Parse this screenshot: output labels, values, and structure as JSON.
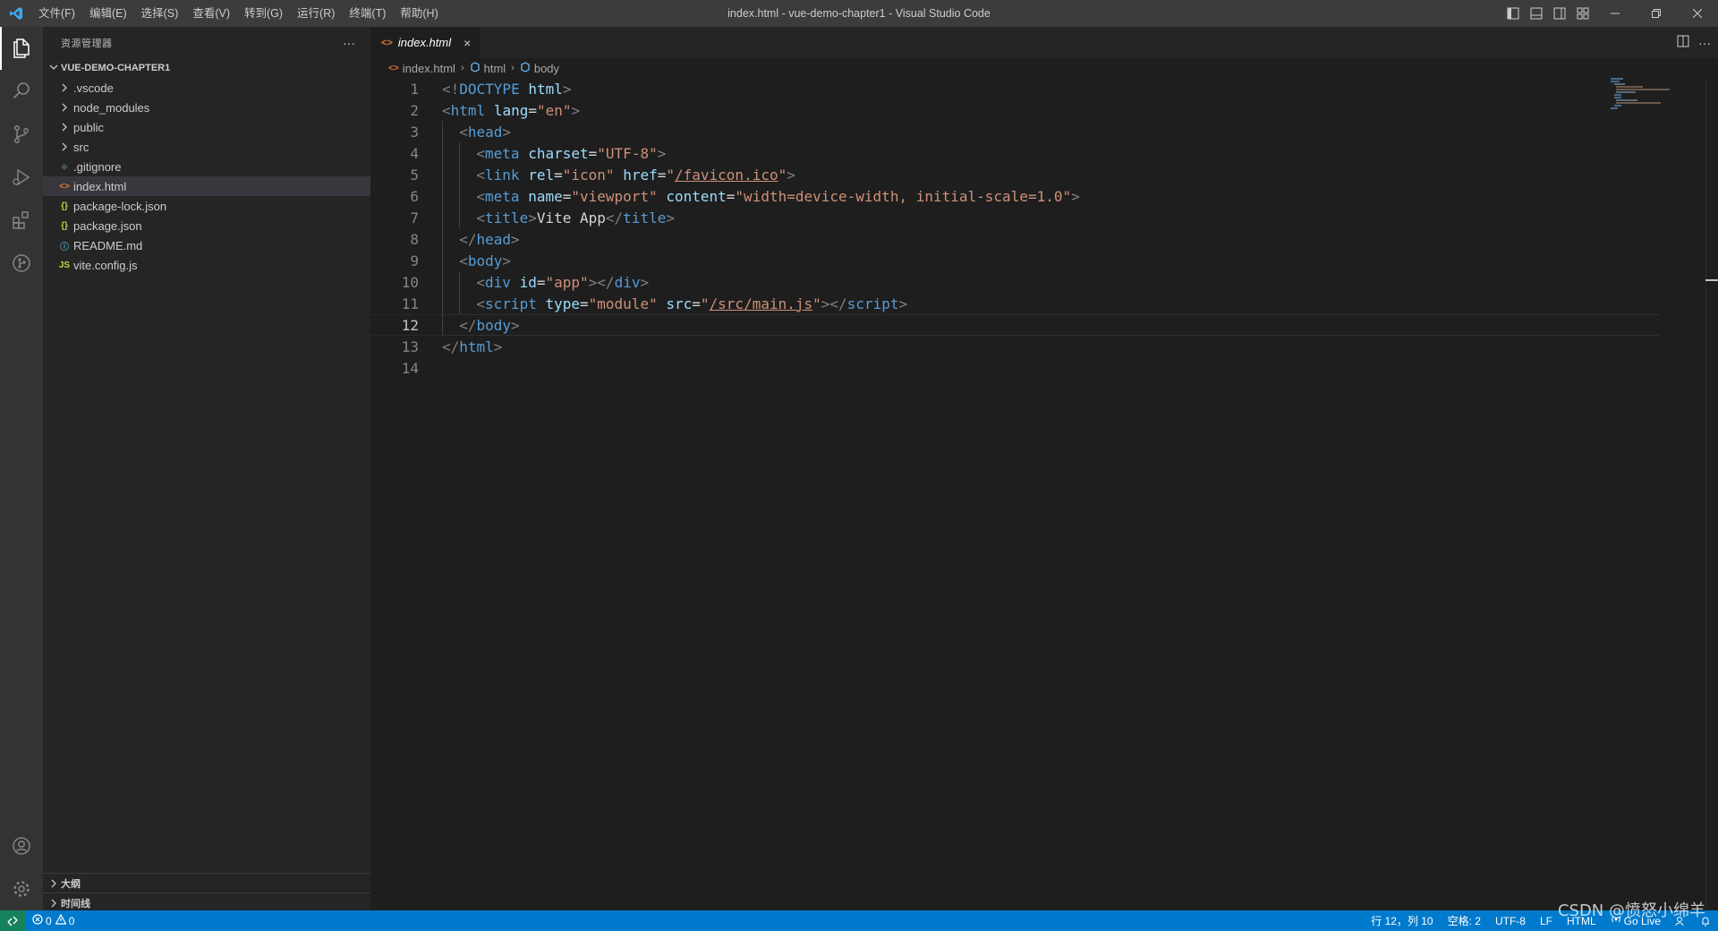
{
  "window": {
    "title": "index.html - vue-demo-chapter1 - Visual Studio Code"
  },
  "menu": [
    "文件(F)",
    "编辑(E)",
    "选择(S)",
    "查看(V)",
    "转到(G)",
    "运行(R)",
    "终端(T)",
    "帮助(H)"
  ],
  "activity_bar": {
    "top": [
      "explorer-icon",
      "search-icon",
      "source-control-icon",
      "run-debug-icon",
      "extensions-icon",
      "git-graph-icon"
    ],
    "bottom": [
      "account-icon",
      "settings-gear-icon"
    ]
  },
  "sidebar": {
    "title": "资源管理器",
    "more": "···",
    "folder": "VUE-DEMO-CHAPTER1",
    "items": [
      {
        "label": ".vscode",
        "type": "folder"
      },
      {
        "label": "node_modules",
        "type": "folder"
      },
      {
        "label": "public",
        "type": "folder"
      },
      {
        "label": "src",
        "type": "folder"
      },
      {
        "label": ".gitignore",
        "type": "git"
      },
      {
        "label": "index.html",
        "type": "html",
        "selected": true
      },
      {
        "label": "package-lock.json",
        "type": "json"
      },
      {
        "label": "package.json",
        "type": "json"
      },
      {
        "label": "README.md",
        "type": "info"
      },
      {
        "label": "vite.config.js",
        "type": "js"
      }
    ],
    "sections": [
      "大纲",
      "时间线"
    ]
  },
  "editor": {
    "tab": {
      "label": "index.html",
      "close": "×"
    },
    "more": "···",
    "breadcrumbs": [
      "index.html",
      "html",
      "body"
    ],
    "current_line": 12,
    "lines": [
      {
        "n": "1",
        "indent": 0
      },
      {
        "n": "2",
        "indent": 0
      },
      {
        "n": "3",
        "indent": 1
      },
      {
        "n": "4",
        "indent": 2
      },
      {
        "n": "5",
        "indent": 2
      },
      {
        "n": "6",
        "indent": 2
      },
      {
        "n": "7",
        "indent": 2
      },
      {
        "n": "8",
        "indent": 1
      },
      {
        "n": "9",
        "indent": 1
      },
      {
        "n": "10",
        "indent": 2
      },
      {
        "n": "11",
        "indent": 2
      },
      {
        "n": "12",
        "indent": 1
      },
      {
        "n": "13",
        "indent": 0
      },
      {
        "n": "14",
        "indent": 0
      }
    ],
    "tokens": [
      [
        [
          "punc",
          "<!"
        ],
        [
          "tag",
          "DOCTYPE"
        ],
        [
          "text",
          " "
        ],
        [
          "attr",
          "html"
        ],
        [
          "punc",
          ">"
        ]
      ],
      [
        [
          "punc",
          "<"
        ],
        [
          "tag",
          "html"
        ],
        [
          "text",
          " "
        ],
        [
          "attr",
          "lang"
        ],
        [
          "text",
          "="
        ],
        [
          "str",
          "\"en\""
        ],
        [
          "punc",
          ">"
        ]
      ],
      [
        [
          "punc",
          "<"
        ],
        [
          "tag",
          "head"
        ],
        [
          "punc",
          ">"
        ]
      ],
      [
        [
          "punc",
          "<"
        ],
        [
          "tag",
          "meta"
        ],
        [
          "text",
          " "
        ],
        [
          "attr",
          "charset"
        ],
        [
          "text",
          "="
        ],
        [
          "str",
          "\"UTF-8\""
        ],
        [
          "punc",
          ">"
        ]
      ],
      [
        [
          "punc",
          "<"
        ],
        [
          "tag",
          "link"
        ],
        [
          "text",
          " "
        ],
        [
          "attr",
          "rel"
        ],
        [
          "text",
          "="
        ],
        [
          "str",
          "\"icon\""
        ],
        [
          "text",
          " "
        ],
        [
          "attr",
          "href"
        ],
        [
          "text",
          "="
        ],
        [
          "str",
          "\""
        ],
        [
          "link",
          "/favicon.ico"
        ],
        [
          "str",
          "\""
        ],
        [
          "punc",
          ">"
        ]
      ],
      [
        [
          "punc",
          "<"
        ],
        [
          "tag",
          "meta"
        ],
        [
          "text",
          " "
        ],
        [
          "attr",
          "name"
        ],
        [
          "text",
          "="
        ],
        [
          "str",
          "\"viewport\""
        ],
        [
          "text",
          " "
        ],
        [
          "attr",
          "content"
        ],
        [
          "text",
          "="
        ],
        [
          "str",
          "\"width=device-width, initial-scale=1.0\""
        ],
        [
          "punc",
          ">"
        ]
      ],
      [
        [
          "punc",
          "<"
        ],
        [
          "tag",
          "title"
        ],
        [
          "punc",
          ">"
        ],
        [
          "text",
          "Vite App"
        ],
        [
          "punc",
          "</"
        ],
        [
          "tag",
          "title"
        ],
        [
          "punc",
          ">"
        ]
      ],
      [
        [
          "punc",
          "</"
        ],
        [
          "tag",
          "head"
        ],
        [
          "punc",
          ">"
        ]
      ],
      [
        [
          "punc",
          "<"
        ],
        [
          "tag",
          "body"
        ],
        [
          "punc",
          ">"
        ]
      ],
      [
        [
          "punc",
          "<"
        ],
        [
          "tag",
          "div"
        ],
        [
          "text",
          " "
        ],
        [
          "attr",
          "id"
        ],
        [
          "text",
          "="
        ],
        [
          "str",
          "\"app\""
        ],
        [
          "punc",
          "></"
        ],
        [
          "tag",
          "div"
        ],
        [
          "punc",
          ">"
        ]
      ],
      [
        [
          "punc",
          "<"
        ],
        [
          "tag",
          "script"
        ],
        [
          "text",
          " "
        ],
        [
          "attr",
          "type"
        ],
        [
          "text",
          "="
        ],
        [
          "str",
          "\"module\""
        ],
        [
          "text",
          " "
        ],
        [
          "attr",
          "src"
        ],
        [
          "text",
          "="
        ],
        [
          "str",
          "\""
        ],
        [
          "link",
          "/src/main.js"
        ],
        [
          "str",
          "\""
        ],
        [
          "punc",
          "></"
        ],
        [
          "tag",
          "script"
        ],
        [
          "punc",
          ">"
        ]
      ],
      [
        [
          "punc",
          "</"
        ],
        [
          "tag",
          "body"
        ],
        [
          "punc",
          ">"
        ]
      ],
      [
        [
          "punc",
          "</"
        ],
        [
          "tag",
          "html"
        ],
        [
          "punc",
          ">"
        ]
      ],
      []
    ]
  },
  "statusbar": {
    "errors": "0",
    "warnings": "0",
    "position": "行 12，列 10",
    "spaces": "空格: 2",
    "encoding": "UTF-8",
    "eol": "LF",
    "language": "HTML",
    "go_live": "Go Live"
  },
  "watermark": "CSDN @愤怒小绵羊",
  "colors": {
    "accent": "#007acc",
    "tag": "#569cd6",
    "attr": "#9cdcfe",
    "string": "#ce9178",
    "punctuation": "#808080"
  }
}
